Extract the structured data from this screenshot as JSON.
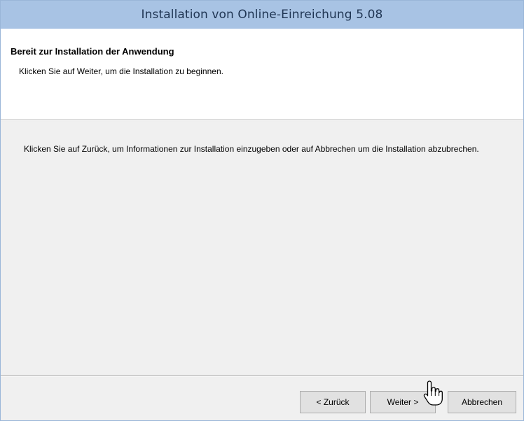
{
  "window": {
    "title": "Installation von Online-Einreichung 5.08"
  },
  "header": {
    "title": "Bereit zur Installation der Anwendung",
    "subtitle": "Klicken Sie auf Weiter, um die Installation zu beginnen."
  },
  "body": {
    "text": "Klicken Sie auf Zurück, um Informationen zur Installation einzugeben oder auf Abbrechen um die Installation abzubrechen."
  },
  "buttons": {
    "back_label": "< Zurück",
    "next_label": "Weiter >",
    "cancel_label": "Abbrechen"
  },
  "cursor": {
    "icon": "hand-pointer-icon"
  },
  "colors": {
    "titlebar": "#a8c3e4",
    "window_border": "#9ab6d8",
    "dialog_background": "#f0f0f0",
    "header_background": "#ffffff",
    "button_face": "#e1e1e1"
  }
}
